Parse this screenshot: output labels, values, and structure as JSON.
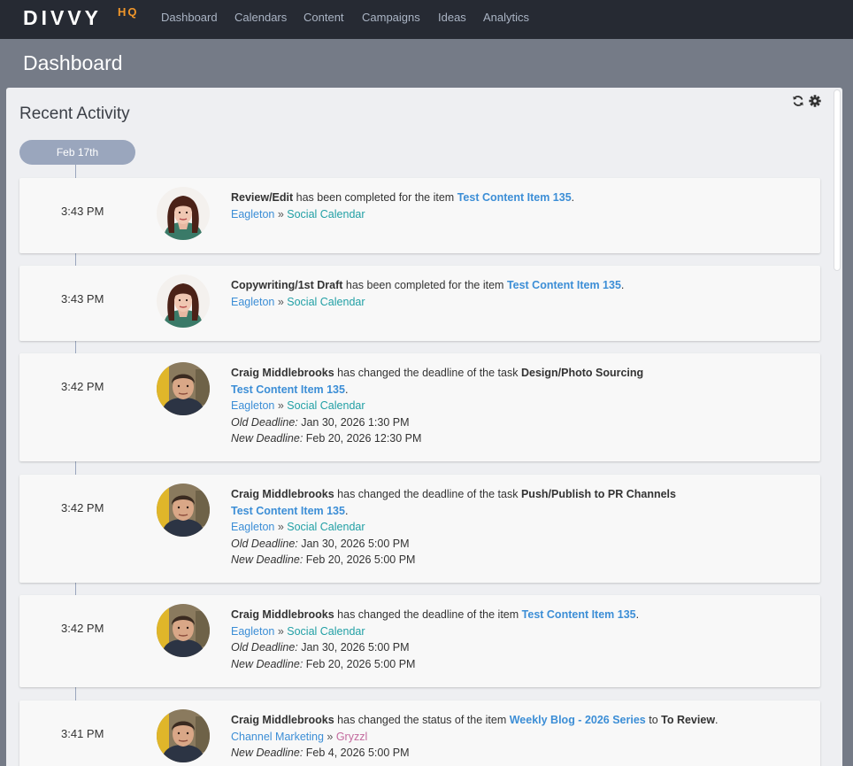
{
  "nav": {
    "logo_main": "DIVVY",
    "logo_sub": "HQ",
    "items": [
      "Dashboard",
      "Calendars",
      "Content",
      "Campaigns",
      "Ideas",
      "Analytics"
    ]
  },
  "page": {
    "title": "Dashboard"
  },
  "panel": {
    "title": "Recent Activity",
    "date_group": "Feb 17th",
    "refresh_icon": "refresh-icon",
    "settings_icon": "gear-icon"
  },
  "colors": {
    "nav_bg": "#262a33",
    "page_bg": "#757b87",
    "panel_bg": "#eeeff2",
    "link_blue": "#3c8ed6",
    "link_teal": "#22a0a5",
    "link_pink": "#c36a9e",
    "logo_accent": "#f0962a"
  },
  "activities": [
    {
      "time": "3:43 PM",
      "avatar": "woman-avatar",
      "task": "Review/Edit",
      "text": " has been completed for the item ",
      "item": "Test Content Item 135",
      "end": ".",
      "org": "Eagleton",
      "sep": " » ",
      "calendar": "Social Calendar"
    },
    {
      "time": "3:43 PM",
      "avatar": "woman-avatar",
      "task": "Copywriting/1st Draft",
      "text": " has been completed for the item ",
      "item": "Test Content Item 135",
      "end": ".",
      "org": "Eagleton",
      "sep": " » ",
      "calendar": "Social Calendar"
    },
    {
      "time": "3:42 PM",
      "avatar": "man-avatar",
      "user": "Craig Middlebrooks",
      "text": " has changed the deadline of the task ",
      "task": "Design/Photo Sourcing",
      "item": "Test Content Item 135",
      "end": ".",
      "org": "Eagleton",
      "sep": " » ",
      "calendar": "Social Calendar",
      "old_label": "Old Deadline:",
      "old_value": " Jan 30, 2026 1:30 PM",
      "new_label": "New Deadline:",
      "new_value": " Feb 20, 2026 12:30 PM"
    },
    {
      "time": "3:42 PM",
      "avatar": "man-avatar",
      "user": "Craig Middlebrooks",
      "text": " has changed the deadline of the task ",
      "task": "Push/Publish to PR Channels",
      "item": "Test Content Item 135",
      "end": ".",
      "org": "Eagleton",
      "sep": " » ",
      "calendar": "Social Calendar",
      "old_label": "Old Deadline:",
      "old_value": " Jan 30, 2026 5:00 PM",
      "new_label": "New Deadline:",
      "new_value": " Feb 20, 2026 5:00 PM"
    },
    {
      "time": "3:42 PM",
      "avatar": "man-avatar",
      "user": "Craig Middlebrooks",
      "text": " has changed the deadline of the item ",
      "item": "Test Content Item 135",
      "end": ".",
      "org": "Eagleton",
      "sep": " » ",
      "calendar": "Social Calendar",
      "old_label": "Old Deadline:",
      "old_value": " Jan 30, 2026 5:00 PM",
      "new_label": "New Deadline:",
      "new_value": " Feb 20, 2026 5:00 PM"
    },
    {
      "time": "3:41 PM",
      "avatar": "man-avatar",
      "user": "Craig Middlebrooks",
      "text": " has changed the status of the item ",
      "item": "Weekly Blog - 2026 Series",
      "to": " to ",
      "status": "To Review",
      "end": ".",
      "org": "Channel Marketing",
      "sep": " » ",
      "calendar": "Gryzzl",
      "new_label": "New Deadline:",
      "new_value": " Feb 4, 2026 5:00 PM"
    }
  ]
}
